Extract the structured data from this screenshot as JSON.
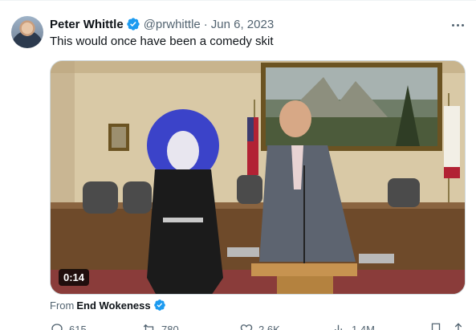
{
  "tweet": {
    "author_name": "Peter Whittle",
    "handle": "@prwhittle",
    "separator": "·",
    "date": "Jun 6, 2023",
    "text": "This would once have been a comedy skit",
    "media": {
      "duration": "0:14"
    },
    "source": {
      "prefix": "From",
      "name": "End Wokeness"
    },
    "stats": {
      "replies": "615",
      "reposts": "780",
      "likes": "2.6K",
      "views": "1.4M"
    }
  },
  "icons": {
    "verified": "verified-badge-icon",
    "more": "more-options-icon",
    "reply": "reply-icon",
    "repost": "repost-icon",
    "like": "heart-icon",
    "views": "analytics-icon",
    "bookmark": "bookmark-icon",
    "share": "share-icon"
  },
  "colors": {
    "verified": "#1d9bf0",
    "text_primary": "#0f1419",
    "text_secondary": "#536471"
  }
}
